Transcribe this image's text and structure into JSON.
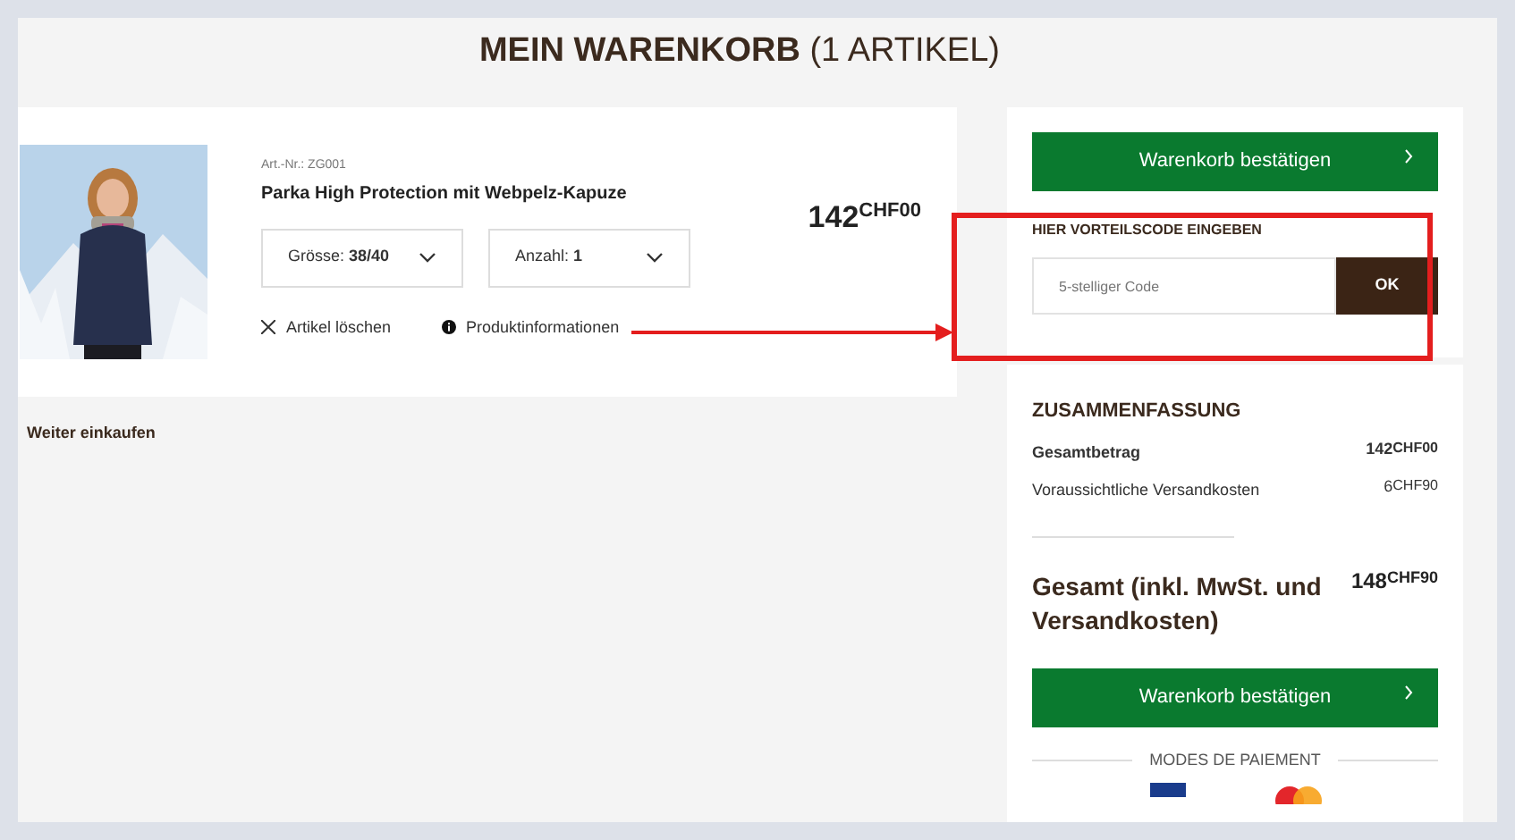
{
  "title": {
    "main": "MEIN WARENKORB",
    "count": "(1 ARTIKEL)"
  },
  "item": {
    "article_no": "Art.-Nr.: ZG001",
    "name": "Parka High Protection mit Webpelz-Kapuze",
    "selects": [
      {
        "label": "Grösse:",
        "value": "38/40"
      },
      {
        "label": "Anzahl:",
        "value": "1"
      }
    ],
    "price": {
      "amount": "142",
      "cents": "CHF00"
    },
    "actions": [
      {
        "kind": "delete",
        "label": "Artikel löschen"
      },
      {
        "kind": "info",
        "label": "Produktinformationen"
      }
    ]
  },
  "continue_link": "Weiter einkaufen",
  "confirm_button_top": "Warenkorb bestätigen",
  "voucher": {
    "heading": "HIER VORTEILSCODE EINGEBEN",
    "placeholder": "5-stelliger Code",
    "button": "OK"
  },
  "summary": {
    "heading": "ZUSAMMENFASSUNG",
    "rows": [
      {
        "label": "Gesamtbetrag",
        "amount": "142",
        "cents": "CHF00",
        "bold": true
      },
      {
        "label": "Voraussichtliche Versandkosten",
        "amount": "6",
        "cents": "CHF90",
        "bold": false
      }
    ],
    "total": {
      "label": "Gesamt (inkl. MwSt. und Versandkosten)",
      "amount": "148",
      "cents": "CHF90"
    },
    "confirm_button": "Warenkorb bestätigen",
    "payment_heading": "MODES DE PAIEMENT"
  }
}
